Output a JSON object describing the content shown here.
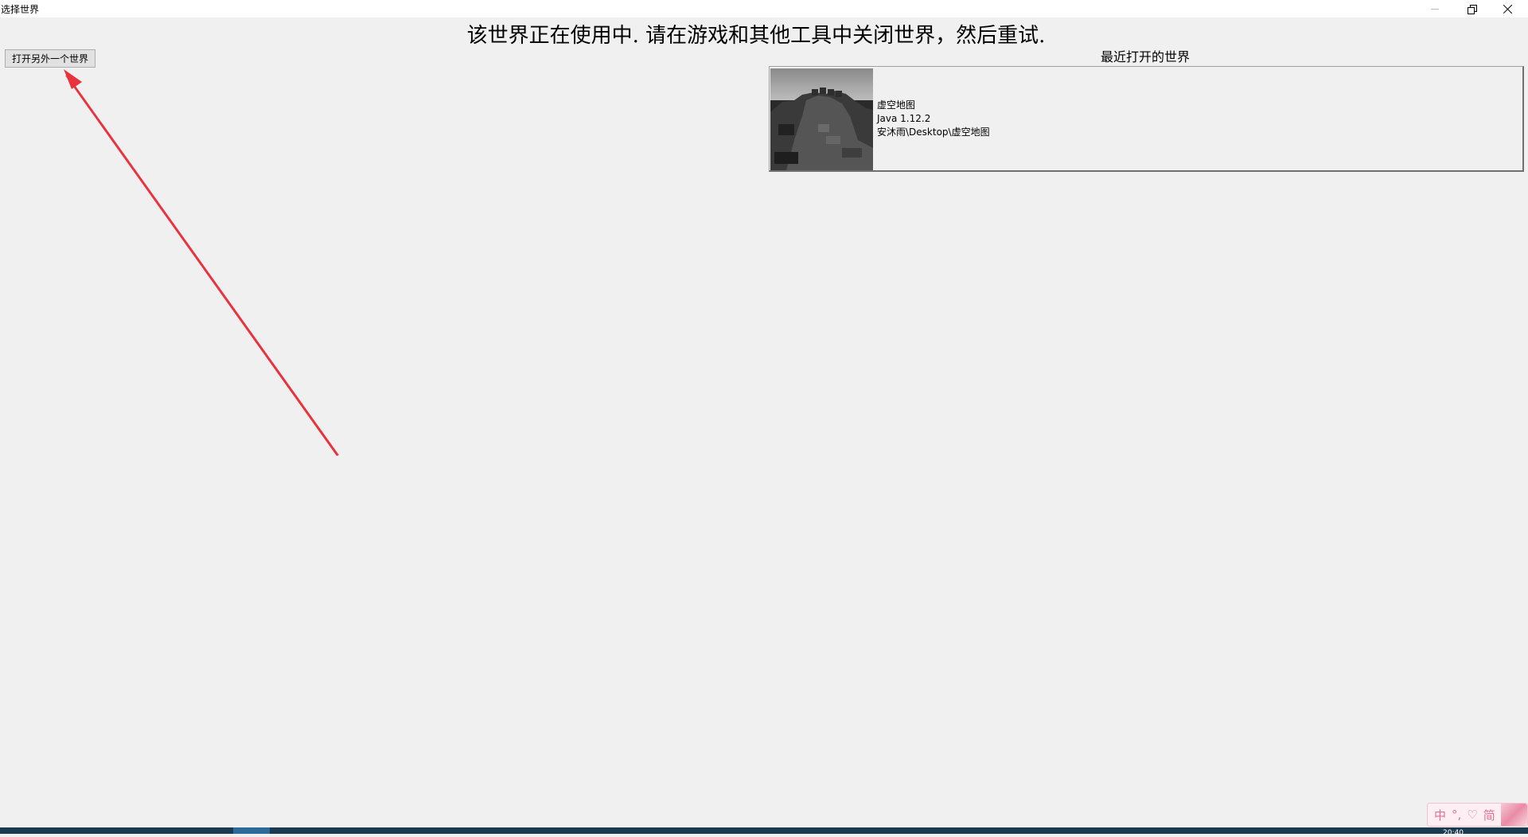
{
  "window": {
    "title": "选择世界"
  },
  "message": {
    "error": "该世界正在使用中.  请在游戏和其他工具中关闭世界，然后重试."
  },
  "actions": {
    "open_other_label": "打开另外一个世界"
  },
  "recent": {
    "heading": "最近打开的世界",
    "worlds": [
      {
        "name": "虚空地图",
        "version": "Java 1.12.2",
        "path": "安沐雨\\Desktop\\虚空地图"
      }
    ]
  },
  "ime": {
    "mode": "中",
    "punct": "°,",
    "heart": "♡",
    "simplified": "简"
  },
  "taskbar": {
    "clock": "20:40"
  },
  "colors": {
    "background": "#f0f0f0",
    "annotation_arrow": "#e8323c",
    "taskbar": "#1b3a4f"
  },
  "icons": {
    "minimize": "minimize-icon",
    "maximize": "restore-icon",
    "close": "close-icon",
    "thumbnail": "world-thumbnail"
  }
}
